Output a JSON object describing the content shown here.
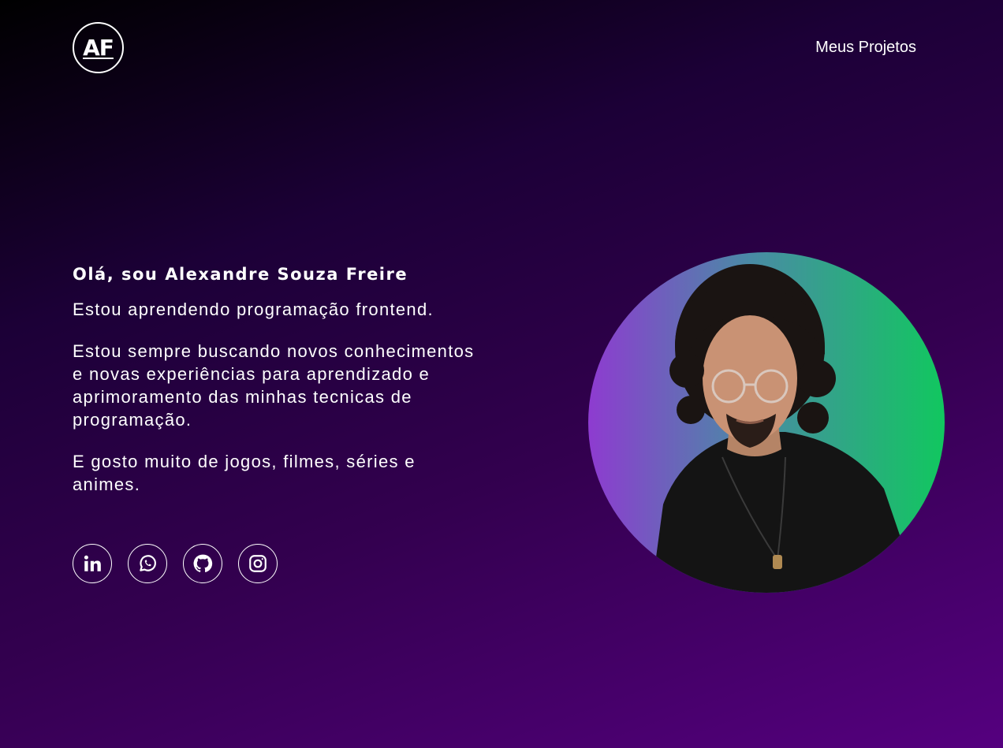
{
  "header": {
    "logo_text": "AF",
    "nav_link": "Meus Projetos"
  },
  "intro": {
    "greeting": "Olá, sou Alexandre Souza Freire",
    "paragraphs": [
      "Estou aprendendo programação frontend.",
      "Estou sempre buscando novos conhecimentos e novas experiências para aprendizado e aprimoramento das minhas tecnicas de programação.",
      "E gosto muito de jogos, filmes, séries e animes."
    ]
  },
  "socials": [
    {
      "icon": "linkedin-icon"
    },
    {
      "icon": "whatsapp-icon"
    },
    {
      "icon": "github-icon"
    },
    {
      "icon": "instagram-icon"
    }
  ],
  "colors": {
    "background_start": "#000000",
    "background_end": "#55007f",
    "photo_gradient_left": "#8e3bd0",
    "photo_gradient_right": "#11c75f"
  }
}
